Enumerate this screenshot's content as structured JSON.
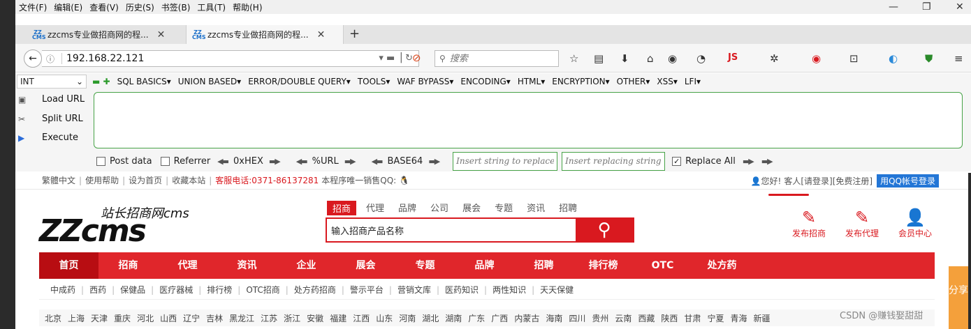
{
  "menu": [
    "文件(F)",
    "编辑(E)",
    "查看(V)",
    "历史(S)",
    "书签(B)",
    "工具(T)",
    "帮助(H)"
  ],
  "tabs": [
    {
      "favicon": "ZZ CMS",
      "title": "zzcms专业做招商网的程..."
    },
    {
      "favicon": "ZZ CMS",
      "title": "zzcms专业做招商网的程..."
    }
  ],
  "nav": {
    "url": "192.168.22.121",
    "search_placeholder": "搜索",
    "js_label": "JS"
  },
  "hackbar": {
    "select_value": "INT",
    "menus": [
      "SQL BASICS▾",
      "UNION BASED▾",
      "ERROR/DOUBLE QUERY▾",
      "TOOLS▾",
      "WAF BYPASS▾",
      "ENCODING▾",
      "HTML▾",
      "ENCRYPTION▾",
      "OTHER▾",
      "XSS▾",
      "LFI▾"
    ],
    "load_url": "Load URL",
    "split_url": "Split URL",
    "execute": "Execute",
    "post_data": "Post data",
    "referrer": "Referrer",
    "hex": "0xHEX",
    "url_enc": "%URL",
    "base64": "BASE64",
    "insert_replace_ph": "Insert string to replace",
    "insert_replacing_ph": "Insert replacing string",
    "replace_all": "Replace All"
  },
  "site": {
    "topline": [
      "繁體中文",
      "使用帮助",
      "设为首页",
      "收藏本站"
    ],
    "hotline": "客服电话:0371-86137281",
    "qq_text": "本程序唯一销售QQ:",
    "greeting": "您好!",
    "guest": "客人",
    "login": "[请登录]",
    "register": "[免费注册]",
    "qq_login": "用QQ帐号登录",
    "logo_main": "ZZcms",
    "logo_sub": "站长招商网cms",
    "search_tabs": [
      "招商",
      "代理",
      "品牌",
      "公司",
      "展会",
      "专题",
      "资讯",
      "招聘"
    ],
    "search_value": "输入招商产品名称",
    "quick": [
      "发布招商",
      "发布代理",
      "会员中心"
    ],
    "mainnav": [
      "首页",
      "招商",
      "代理",
      "资讯",
      "企业",
      "展会",
      "专题",
      "品牌",
      "招聘",
      "排行榜",
      "OTC",
      "处方药"
    ],
    "subnav": [
      "中成药",
      "西药",
      "保健品",
      "医疗器械",
      "排行榜",
      "OTC招商",
      "处方药招商",
      "警示平台",
      "营销文库",
      "医药知识",
      "两性知识",
      "天天保健"
    ],
    "regions": [
      "北京",
      "上海",
      "天津",
      "重庆",
      "河北",
      "山西",
      "辽宁",
      "吉林",
      "黑龙江",
      "江苏",
      "浙江",
      "安徽",
      "福建",
      "江西",
      "山东",
      "河南",
      "湖北",
      "湖南",
      "广东",
      "广西",
      "内蒙古",
      "海南",
      "四川",
      "贵州",
      "云南",
      "西藏",
      "陕西",
      "甘肃",
      "宁夏",
      "青海",
      "新疆"
    ],
    "share": "分享",
    "watermark": "CSDN @赚钱娶甜甜"
  }
}
